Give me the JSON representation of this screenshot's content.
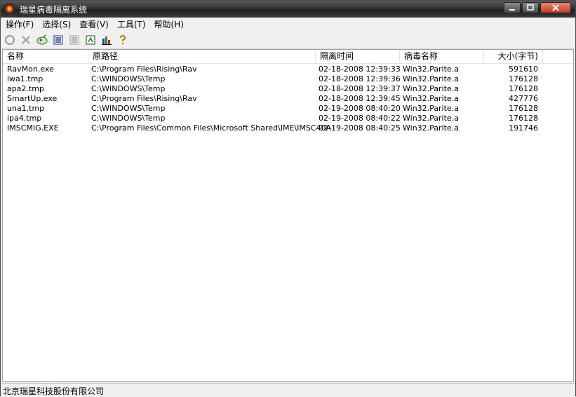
{
  "window": {
    "title": "瑞星病毒隔离系统"
  },
  "menu": [
    "操作(F)",
    "选择(S)",
    "查看(V)",
    "工具(T)",
    "帮助(H)"
  ],
  "toolbar": {
    "buttons": [
      "restore-icon",
      "delete-icon",
      "add-icon",
      "list-view-icon",
      "details-view-icon",
      "properties-icon",
      "chart-icon",
      "help-icon"
    ]
  },
  "table": {
    "columns": [
      "名称",
      "原路径",
      "隔离时间",
      "病毒名称",
      "大小(字节)"
    ],
    "rows": [
      [
        "RavMon.exe",
        "C:\\Program Files\\Rising\\Rav",
        "02-18-2008 12:39:33",
        "Win32.Parite.a",
        "591610"
      ],
      [
        "lwa1.tmp",
        "C:\\WINDOWS\\Temp",
        "02-18-2008 12:39:36",
        "Win32.Parite.a",
        "176128"
      ],
      [
        "apa2.tmp",
        "C:\\WINDOWS\\Temp",
        "02-18-2008 12:39:37",
        "Win32.Parite.a",
        "176128"
      ],
      [
        "SmartUp.exe",
        "C:\\Program Files\\Rising\\Rav",
        "02-18-2008 12:39:45",
        "Win32.Parite.a",
        "427776"
      ],
      [
        "una1.tmp",
        "C:\\WINDOWS\\Temp",
        "02-19-2008 08:40:20",
        "Win32.Parite.a",
        "176128"
      ],
      [
        "ipa4.tmp",
        "C:\\WINDOWS\\Temp",
        "02-19-2008 08:40:22",
        "Win32.Parite.a",
        "176128"
      ],
      [
        "IMSCMIG.EXE",
        "C:\\Program Files\\Common Files\\Microsoft Shared\\IME\\IMSC40A",
        "02-19-2008 08:40:25",
        "Win32.Parite.a",
        "191746"
      ]
    ]
  },
  "status": {
    "text": "北京瑞星科技股份有限公司"
  }
}
